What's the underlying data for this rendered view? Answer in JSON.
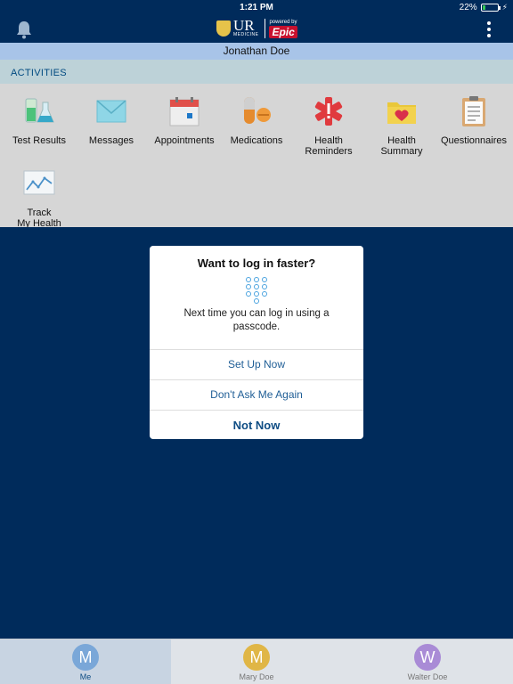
{
  "status": {
    "time": "1:21 PM",
    "battery": "22%"
  },
  "header": {
    "logo_main": "UR",
    "logo_sub": "MEDICINE",
    "powered_by": "powered by",
    "epic": "Epic"
  },
  "user": {
    "name": "Jonathan Doe"
  },
  "activities": {
    "heading": "ACTIVITIES",
    "items": [
      {
        "label": "Test Results",
        "icon": "test-tubes-icon"
      },
      {
        "label": "Messages",
        "icon": "envelope-icon"
      },
      {
        "label": "Appointments",
        "icon": "calendar-icon"
      },
      {
        "label": "Medications",
        "icon": "pills-icon"
      },
      {
        "label": "Health\nReminders",
        "icon": "medical-star-icon"
      },
      {
        "label": "Health\nSummary",
        "icon": "heart-folder-icon"
      },
      {
        "label": "Questionnaires",
        "icon": "clipboard-icon"
      },
      {
        "label": "Track\nMy Health",
        "icon": "chart-icon"
      }
    ]
  },
  "dialog": {
    "title": "Want to log in faster?",
    "message": "Next time you can log in using a passcode.",
    "setup": "Set Up Now",
    "dont_ask": "Don't Ask Me Again",
    "not_now": "Not Now"
  },
  "tabs": [
    {
      "initial": "M",
      "label": "Me",
      "color": "#7aa7d8",
      "label_color": "#0f4d84"
    },
    {
      "initial": "M",
      "label": "Mary Doe",
      "color": "#e0b646",
      "label_color": "#777777"
    },
    {
      "initial": "W",
      "label": "Walter Doe",
      "color": "#a98bd6",
      "label_color": "#777777"
    }
  ],
  "colors": {
    "navy": "#002b5b",
    "accent_blue": "#1f5e96"
  }
}
